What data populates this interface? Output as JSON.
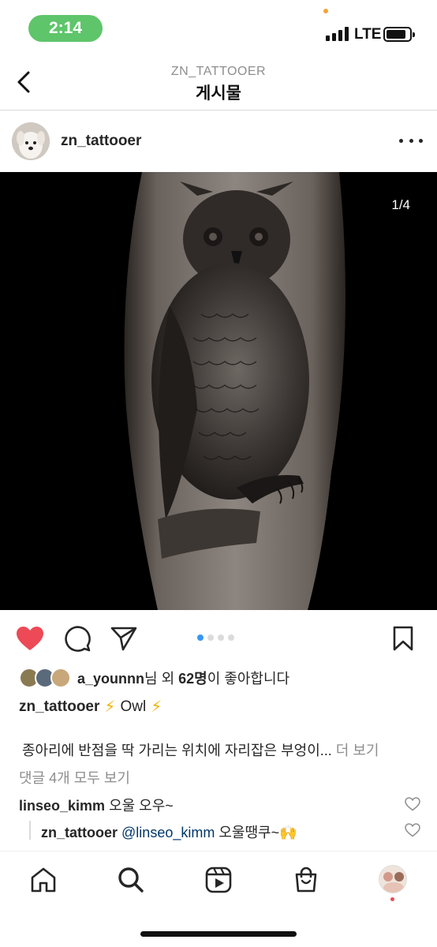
{
  "status_bar": {
    "time": "2:14",
    "network": "LTE"
  },
  "header": {
    "account": "ZN_TATTOOER",
    "title": "게시물"
  },
  "post": {
    "username": "zn_tattooer",
    "image_counter": "1/4",
    "carousel_index": 1,
    "carousel_total": 4
  },
  "likes": {
    "liker": "a_younnn",
    "suffix_before_count": "님 외 ",
    "count": "62명",
    "suffix_after_count": "이 좋아합니다"
  },
  "caption": {
    "username": "zn_tattooer",
    "emoji_left": "⚡",
    "text": "Owl",
    "emoji_right": "⚡",
    "body": "종아리에 반점을 딱 가리는 위치에 자리잡은 부엉이...",
    "more_label": "더 보기"
  },
  "comments": {
    "view_all_label": "댓글 4개 모두 보기",
    "items": [
      {
        "username": "linseo_kimm",
        "text": "오울 오우~"
      },
      {
        "username": "zn_tattooer",
        "mention": "@linseo_kimm",
        "text": "오울땡쿠~🙌"
      }
    ]
  },
  "colors": {
    "like_red": "#ed4956",
    "carousel_active": "#3897f0",
    "time_pill": "#5ec56a",
    "mention": "#00376b"
  },
  "icons": {
    "header": [
      "chevron-left-icon",
      "more-horizontal-icon"
    ],
    "actions": [
      "heart-filled-icon",
      "comment-icon",
      "share-icon",
      "bookmark-icon"
    ],
    "tabs": [
      "home-icon",
      "search-icon",
      "reels-icon",
      "shop-icon",
      "profile-avatar"
    ]
  }
}
